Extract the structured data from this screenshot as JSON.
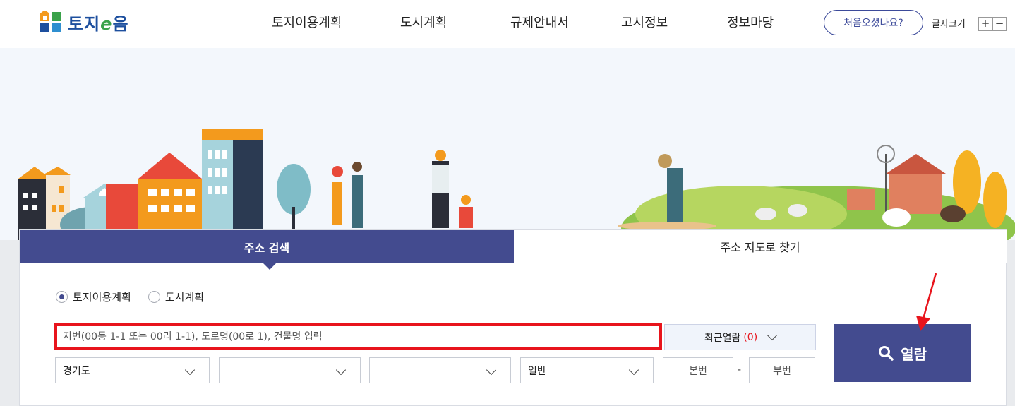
{
  "header": {
    "logo_text_1": "토지",
    "logo_text_e": "e",
    "logo_text_2": "음",
    "nav": [
      "토지이용계획",
      "도시계획",
      "규제안내서",
      "고시정보",
      "정보마당"
    ],
    "first_visit": "처음오셨나요?",
    "font_size_label": "글자크기",
    "font_plus": "+",
    "font_minus": "−"
  },
  "search": {
    "tabs": [
      "주소 검색",
      "주소 지도로 찾기"
    ],
    "radios": [
      {
        "label": "토지이용계획",
        "checked": true
      },
      {
        "label": "도시계획",
        "checked": false
      }
    ],
    "input_placeholder": "지번(00동 1-1 또는 00리 1-1), 도로명(00로 1), 건물명 입력",
    "recent_label": "최근열람",
    "recent_count": "(0)",
    "view_button": "열람",
    "selects": [
      "경기도",
      "",
      "",
      "일반"
    ],
    "main_number": "본번",
    "sub_number": "부번",
    "dash": "-"
  },
  "colors": {
    "accent": "#434b8f",
    "highlight": "#e8141c",
    "brand": "#1d4f9e"
  }
}
